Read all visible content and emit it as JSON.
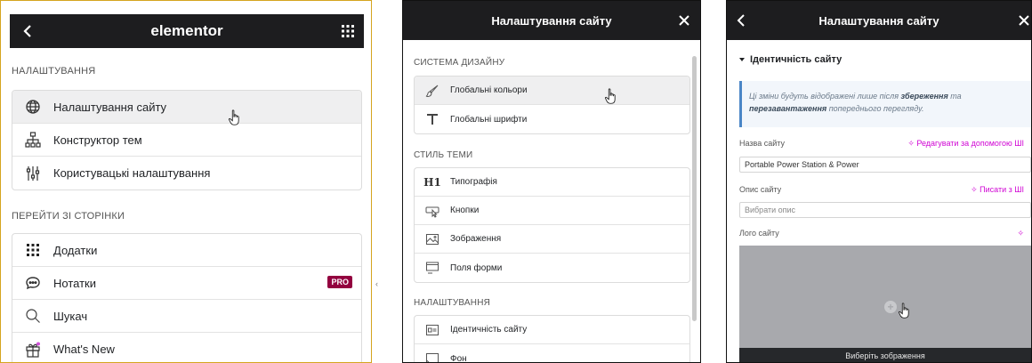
{
  "panel1": {
    "title": "elementor",
    "section_settings": "НАЛАШТУВАННЯ",
    "settings_items": [
      {
        "label": "Налаштування сайту",
        "icon": "globe-icon"
      },
      {
        "label": "Конструктор тем",
        "icon": "sitemap-icon"
      },
      {
        "label": "Користувацькі налаштування",
        "icon": "sliders-icon"
      }
    ],
    "section_goto": "ПЕРЕЙТИ ЗІ СТОРІНКИ",
    "goto_items": [
      {
        "label": "Додатки",
        "icon": "apps-grid-icon"
      },
      {
        "label": "Нотатки",
        "icon": "chat-bubble-icon",
        "badge": "PRO"
      },
      {
        "label": "Шукач",
        "icon": "search-icon"
      },
      {
        "label": "What's New",
        "icon": "gift-icon"
      }
    ]
  },
  "panel2": {
    "title": "Налаштування сайту",
    "section_design": "СИСТЕМА ДИЗАЙНУ",
    "design_items": [
      {
        "label": "Глобальні кольори",
        "icon": "brush-icon"
      },
      {
        "label": "Глобальні шрифти",
        "icon": "font-icon"
      }
    ],
    "section_theme": "СТИЛЬ ТЕМИ",
    "theme_items": [
      {
        "label": "Типографія",
        "icon": "heading-icon"
      },
      {
        "label": "Кнопки",
        "icon": "button-icon"
      },
      {
        "label": "Зображення",
        "icon": "image-icon"
      },
      {
        "label": "Поля форми",
        "icon": "form-field-icon"
      }
    ],
    "section_settings": "НАЛАШТУВАННЯ",
    "settings_items": [
      {
        "label": "Ідентичність сайту",
        "icon": "id-card-icon"
      },
      {
        "label": "Фон",
        "icon": "background-icon"
      }
    ]
  },
  "panel3": {
    "title": "Налаштування сайту",
    "section_title": "Ідентичність сайту",
    "note": {
      "part1": "Ці зміни будуть відображені лише після ",
      "bold1": "збереження",
      "part2": " та ",
      "bold2": "перезавантаження",
      "part3": " попереднього перегляду."
    },
    "site_name_label": "Назва сайту",
    "site_name_ai": "✧ Редагувати за допомогою ШІ",
    "site_name_value": "Portable Power Station & Power",
    "site_desc_label": "Опис сайту",
    "site_desc_ai": "✧ Писати з ШІ",
    "site_desc_placeholder": "Вибрати опис",
    "logo_label": "Лого сайту",
    "logo_ai": "✧",
    "choose_image": "Виберіть зображення"
  }
}
